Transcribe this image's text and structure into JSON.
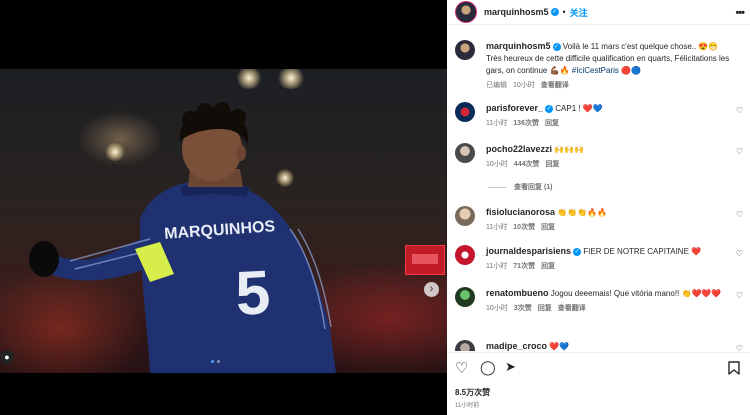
{
  "post": {
    "username": "marquinhosm5",
    "follow_label": "关注",
    "more_icon": "more-horizontal-icon"
  },
  "caption": {
    "username": "marquinhosm5",
    "text": "Voilà le 11 mars c'est quelque chose.. 😍😁 Très heureux de cette difficile qualification en quarts, Félicitations les gars, on continue 💪🏾🔥",
    "hashtag": "#IciCestParis",
    "emojis_after": "🔴🔵",
    "edited": "已编辑",
    "time": "10小时",
    "translate": "查看翻译"
  },
  "comments": [
    {
      "username": "parisforever_",
      "verified": true,
      "text": "CAP1 ! ❤️💙",
      "time": "11小时",
      "likes": "136次赞",
      "reply": "回复"
    },
    {
      "username": "pocho22lavezzi",
      "verified": false,
      "text": "🙌🙌🙌",
      "time": "10小时",
      "likes": "444次赞",
      "reply": "回复",
      "view_replies": "查看回复 (1)"
    },
    {
      "username": "fisiolucianorosa",
      "verified": false,
      "text": "👏👏👏🔥🔥",
      "time": "11小时",
      "likes": "10次赞",
      "reply": "回复"
    },
    {
      "username": "journaldesparisiens",
      "verified": true,
      "text": "FIER DE NOTRE CAPITAINE ❤️",
      "time": "11小时",
      "likes": "71次赞",
      "reply": "回复"
    },
    {
      "username": "renatombueno",
      "verified": false,
      "text": "Jogou deeemais! Que vitória mano!! 👏❤️❤️❤️",
      "time": "10小时",
      "likes": "3次赞",
      "reply": "回复",
      "translate": "查看翻译"
    },
    {
      "username": "madipe_croco",
      "verified": false,
      "text": "❤️💙",
      "time": "",
      "likes": "",
      "reply": ""
    }
  ],
  "media": {
    "jersey_name": "MARQUINHOS",
    "jersey_number": "5"
  },
  "stats": {
    "likes": "8.5万次赞",
    "time": "11小时前"
  },
  "colors": {
    "accent": "#0095f6",
    "jersey": "#1f3170",
    "armband": "#d7ee4a"
  }
}
